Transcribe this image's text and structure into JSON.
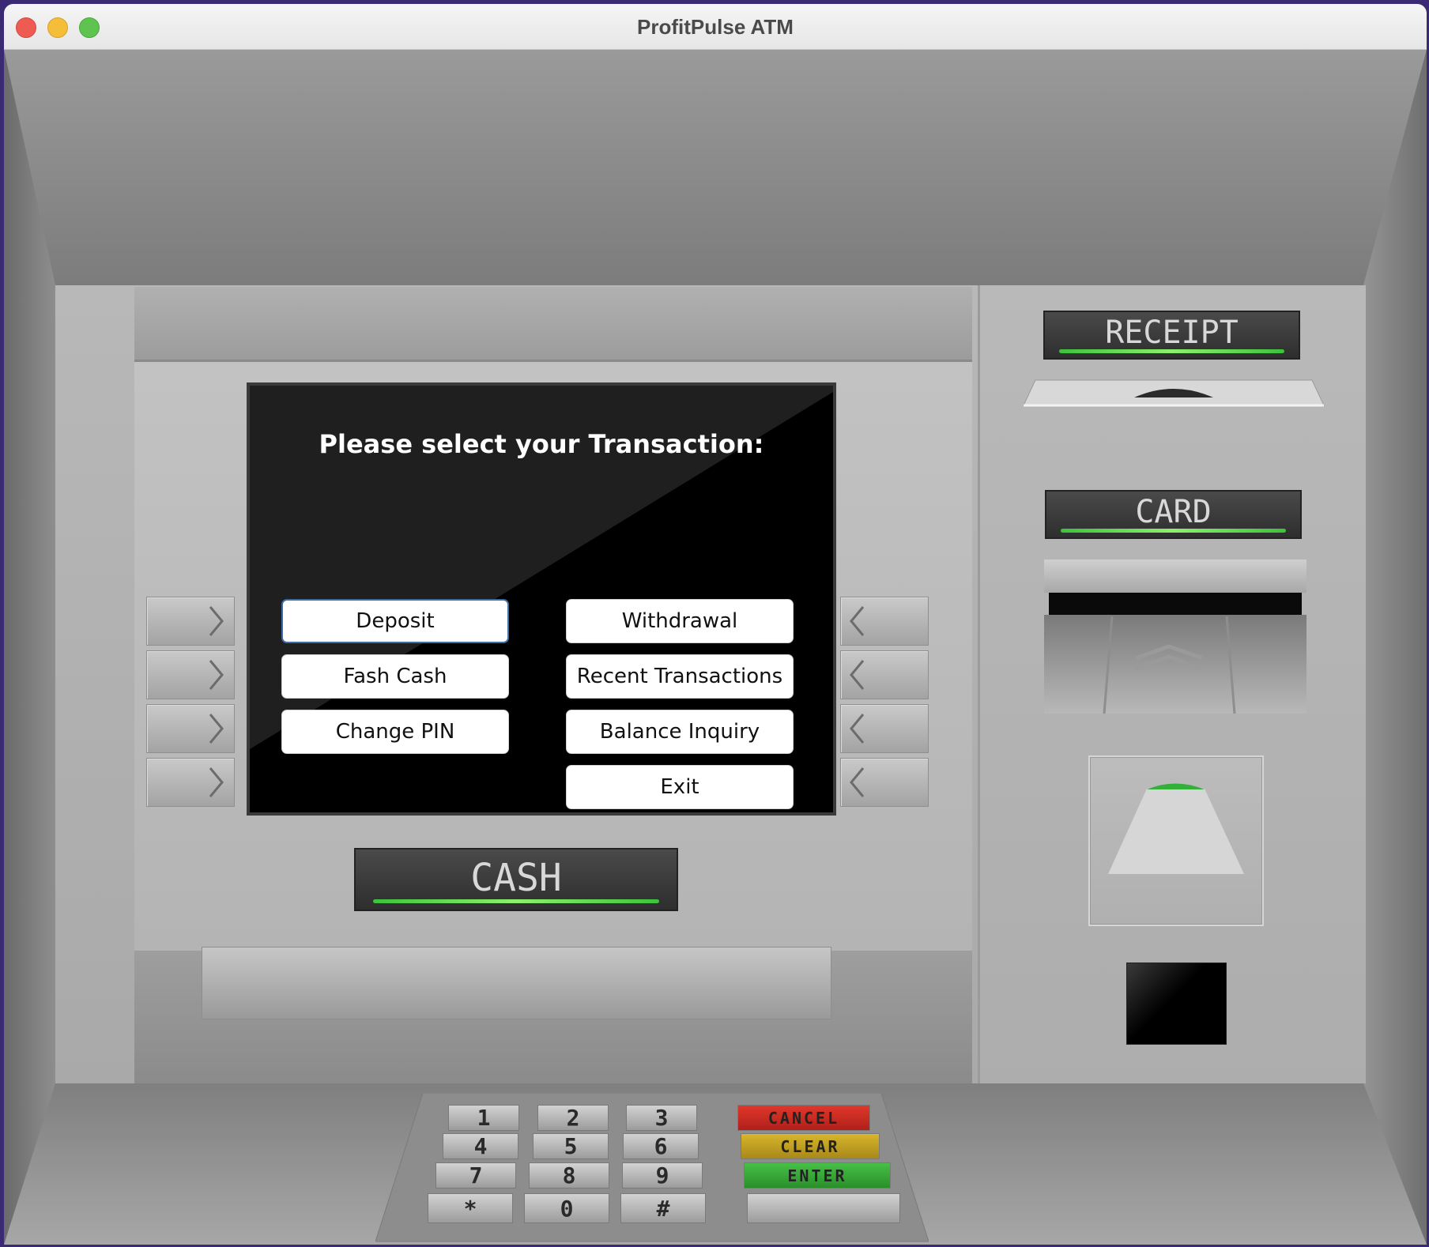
{
  "window": {
    "title": "ProfitPulse ATM"
  },
  "screen": {
    "prompt": "Please select your Transaction:",
    "left_options": [
      "Deposit",
      "Fash Cash",
      "Change PIN"
    ],
    "right_options": [
      "Withdrawal",
      "Recent Transactions",
      "Balance Inquiry",
      "Exit"
    ]
  },
  "labels": {
    "receipt": "RECEIPT",
    "card": "CARD",
    "cash": "CASH"
  },
  "keypad": {
    "digits": [
      "1",
      "2",
      "3",
      "4",
      "5",
      "6",
      "7",
      "8",
      "9",
      "*",
      "0",
      "#"
    ],
    "cancel": "CANCEL",
    "clear": "CLEAR",
    "enter": "ENTER"
  },
  "colors": {
    "cancel": "#d42a1e",
    "clear": "#c9a920",
    "enter": "#36a936",
    "indicator": "#66e04f"
  }
}
